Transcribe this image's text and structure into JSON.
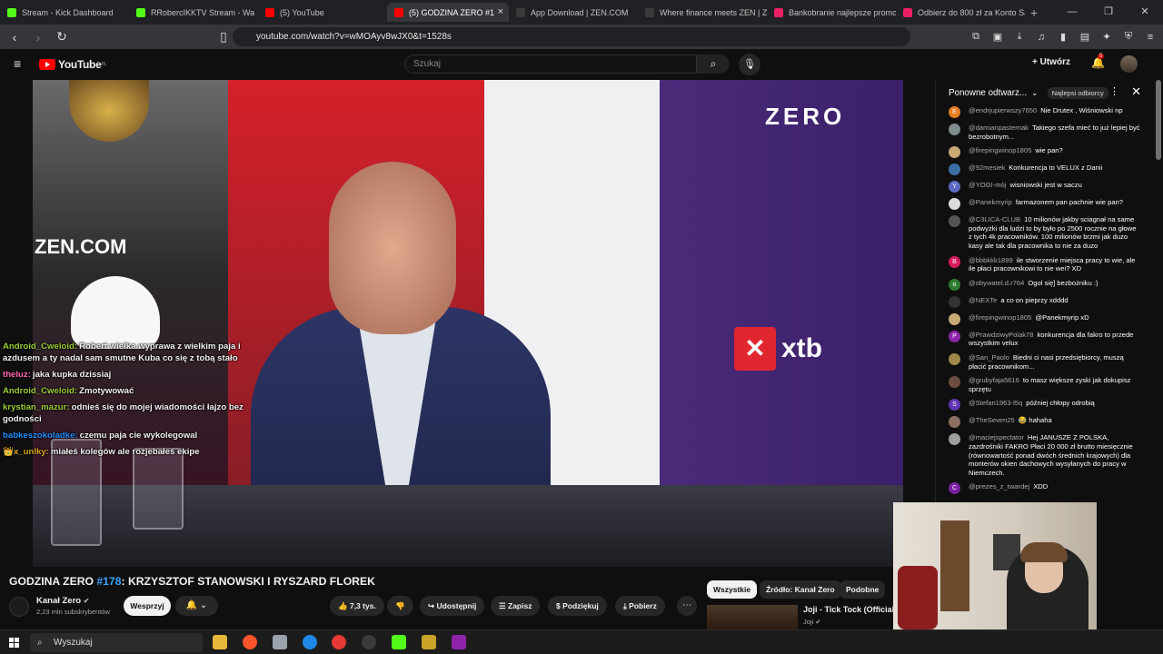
{
  "tabs": [
    {
      "title": "Stream - Kick Dashboard",
      "color": "#53fc18"
    },
    {
      "title": "RRobercIKKTV Stream - Wa",
      "color": "#53fc18"
    },
    {
      "title": "(5) YouTube",
      "color": "#ff0000"
    },
    {
      "title": "(5) GODZINA ZERO #1",
      "color": "#ff0000",
      "active": true
    },
    {
      "title": "App Download | ZEN.COM",
      "color": "#3a3a3a"
    },
    {
      "title": "Where finance meets ZEN | ZE",
      "color": "#3a3a3a"
    },
    {
      "title": "Bankobranie najlepsze promoc",
      "color": "#e91e63"
    },
    {
      "title": "Odbierz do 800 zł za Konto Sa",
      "color": "#e91e63"
    }
  ],
  "browser": {
    "url": "youtube.com/watch?v=wMOAyv8wJX0&t=1528s"
  },
  "youtube": {
    "logo": "YouTube",
    "logo_region": "PL",
    "search_placeholder": "Szukaj",
    "create_label": "Utwórz",
    "notif_count": "5"
  },
  "video": {
    "overlay_zero": "ZERO",
    "overlay_zen": "ZEN.COM",
    "overlay_xtb": "xtb",
    "title_prefix": "GODZINA ZERO ",
    "title_hash": "#178",
    "title_suffix": ": KRZYSZTOF STANOWSKI I RYSZARD FLOREK"
  },
  "twitch_chat": [
    {
      "user": "Android_Cweloid:",
      "text": "Robert wielka wyprawa z wielkim paja i azdusem a ty nadal sam smutne Kuba co się z tobą stało",
      "color": "#9acd32"
    },
    {
      "user": "theluz:",
      "text": "jaka kupka dzissiaj",
      "color": "#ff69b4"
    },
    {
      "user": "Android_Cweloid:",
      "text": "Zmotywować",
      "color": "#9acd32"
    },
    {
      "user": "krystian_mazur:",
      "text": "odnieś się do mojej wiadomości łajzo bez godności",
      "color": "#9acd32"
    },
    {
      "user": "babkeszokoladke:",
      "text": "czemu paja cie wykolegowal",
      "color": "#1e90ff"
    },
    {
      "user": "👑x_unlky:",
      "text": "miałeś kolegów ale rozjebałeś ekipe",
      "color": "#daa520"
    }
  ],
  "live_chat": {
    "header": "Ponowne odtwarz...",
    "pill": "Najlepsi odbiorcy",
    "messages": [
      {
        "avatar": "E",
        "color": "#e67e22",
        "user": "@endrjupierwszy7650",
        "text": "Nie Drutex , Wiśniowski np"
      },
      {
        "avatar": "",
        "color": "#7f8c8d",
        "user": "@damianpasternak",
        "text": "Takiego szefa mieć to już lepiej być bezrobotnym..."
      },
      {
        "avatar": "",
        "color": "#c8a873",
        "user": "@firepingwinop1805",
        "text": "wie pan?"
      },
      {
        "avatar": "",
        "color": "#3b6ea5",
        "user": "@92mesiek",
        "text": "Konkurencja to VELUX z Danii"
      },
      {
        "avatar": "Y",
        "color": "#5c6bc0",
        "user": "@YOGI-mój",
        "text": "wisniowski jest w saczu"
      },
      {
        "avatar": "",
        "color": "#dddddd",
        "user": "@Panekmyrip",
        "text": "farmazonem pan pachnie wie pan?"
      },
      {
        "avatar": "",
        "color": "#555555",
        "user": "@C3LICA-CLUB",
        "text": "10 milionów jakby sciagnał na same podwyżki dla ludzi to by było po 2500 rocznie na głowe z tych 4k pracowników. 100 milionów brzmi jak duzo kasy ale tak dla pracownika to nie za duzo"
      },
      {
        "avatar": "B",
        "color": "#d81b60",
        "user": "@bbbkkk1899",
        "text": "ile stworzenie miejsca pracy to wie, ale ile płaci pracownikowi to nie wei? XD"
      },
      {
        "avatar": "o",
        "color": "#2e7d32",
        "user": "@obywatel.d.r764",
        "text": "Ogol się] bezbożniku :)"
      },
      {
        "avatar": "",
        "color": "#333333",
        "user": "@NEXTe",
        "text": "a co on pieprzy xdddd"
      },
      {
        "avatar": "",
        "color": "#c8a873",
        "user": "@firepingwinop1805",
        "text": "@Panekmyrip xD"
      },
      {
        "avatar": "P",
        "color": "#8e24aa",
        "user": "@PrawdziwyPolak78",
        "text": "konkurencja dla fakro to przede wszystkim velux"
      },
      {
        "avatar": "",
        "color": "#a0884a",
        "user": "@San_Paolo",
        "text": "Biedni ci nasi przedsiębiorcy, muszą płacić pracownikom..."
      },
      {
        "avatar": "",
        "color": "#6d4c41",
        "user": "@grubyfaja5616",
        "text": "to masz większe zyski jak dokupisz sprzętu"
      },
      {
        "avatar": "S",
        "color": "#5e35b1",
        "user": "@Stefan1963-l5q",
        "text": "później chłopy odrobią"
      },
      {
        "avatar": "",
        "color": "#8d6e63",
        "user": "@TheSeven25",
        "text": "😂 hahaha"
      },
      {
        "avatar": "",
        "color": "#9e9e9e",
        "user": "@maciejspectator",
        "text": "Hej JANUSZE Z POLSKA, zazdrośniki FAKRO Płaci 20 000 zł brutto miesięcznie (równowartość ponad dwóch średnich krajowych) dla monterów okien dachowych wysyłanych do pracy w Niemczech."
      },
      {
        "avatar": "C",
        "color": "#7b1fa2",
        "user": "@prezes_z_twardej",
        "text": "XDD"
      }
    ]
  },
  "channel": {
    "name": "Kanał Zero",
    "subs": "2,23 mln subskrybentów",
    "support": "Wesprzyj"
  },
  "actions": {
    "likes": "7,3 tys.",
    "share": "Udostępnij",
    "save": "Zapisz",
    "thanks": "Podziękuj",
    "download": "Pobierz"
  },
  "chips": [
    "Wszystkie",
    "Źródło: Kanał Zero",
    "Podobne"
  ],
  "recommended": {
    "title": "Joji - Tick Tock (Official Vi",
    "channel": "Joji"
  },
  "taskbar": {
    "search": "Wyszukaj"
  }
}
